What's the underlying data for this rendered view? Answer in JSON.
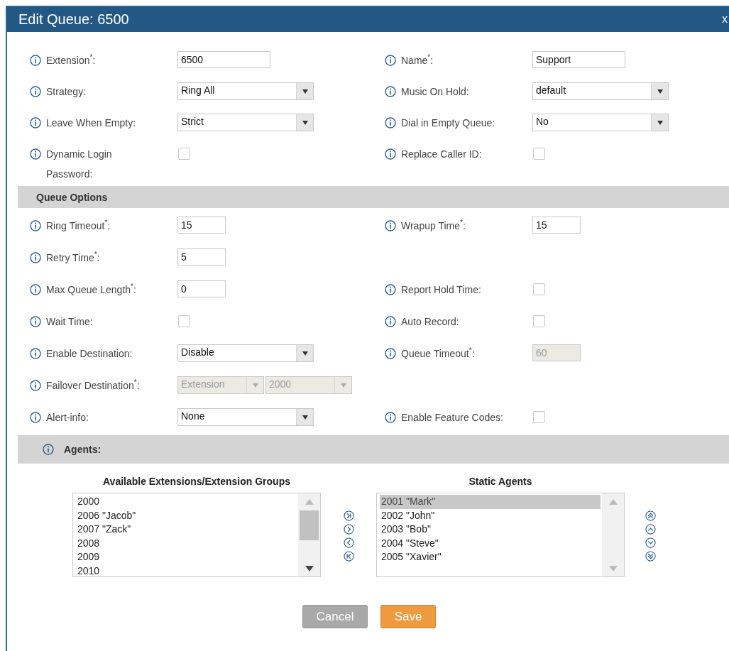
{
  "dialog": {
    "title": "Edit Queue: 6500",
    "close": "x"
  },
  "general_rows": [
    {
      "left": {
        "kind": "text",
        "label": "Extension$^{*}$:",
        "value": "6500",
        "disabled": false
      },
      "right": {
        "kind": "text",
        "label": "Name$^{*}$:",
        "value": "Support",
        "disabled": false
      }
    },
    {
      "left": {
        "kind": "select",
        "label": "Strategy:",
        "value": "Ring All",
        "disabled": false
      },
      "right": {
        "kind": "select",
        "label": "Music On Hold:",
        "value": "default",
        "disabled": false
      }
    },
    {
      "left": {
        "kind": "select",
        "label": "Leave When Empty:",
        "value": "Strict",
        "disabled": false
      },
      "right": {
        "kind": "select",
        "label": "Dial in Empty Queue:",
        "value": "No",
        "disabled": false
      }
    },
    {
      "left": {
        "kind": "checkbox",
        "label": "Dynamic Login Password:",
        "checked": false
      },
      "right": {
        "kind": "checkbox",
        "label": "Replace Caller ID:",
        "checked": false
      }
    }
  ],
  "queue_options": {
    "title": "Queue Options",
    "rows": [
      {
        "left": {
          "kind": "short_text",
          "label": "Ring Timeout$^{*}$:",
          "value": "15",
          "disabled": false
        },
        "right": {
          "kind": "short_text",
          "label": "Wrapup Time$^{*}$:",
          "value": "15",
          "disabled": false
        }
      },
      {
        "left": {
          "kind": "short_text",
          "label": "Retry Time$^{*}$:",
          "value": "5",
          "disabled": false
        }
      },
      {
        "left": {
          "kind": "short_text",
          "label": "Max Queue Length$^{*}$:",
          "value": "0",
          "disabled": false
        },
        "right": {
          "kind": "checkbox",
          "label": "Report Hold Time:",
          "checked": false
        }
      },
      {
        "left": {
          "kind": "checkbox",
          "label": "Wait Time:",
          "checked": false
        },
        "right": {
          "kind": "checkbox",
          "label": "Auto Record:",
          "checked": false
        }
      },
      {
        "left": {
          "kind": "select",
          "label": "Enable Destination:",
          "value": "Disable",
          "disabled": false
        },
        "right": {
          "kind": "short_text",
          "label": "Queue Timeout$^{*}$:",
          "value": "60",
          "disabled": true
        }
      },
      {
        "left": {
          "kind": "select_pair",
          "label": "Failover Destination$^{*}$:",
          "values": [
            "Extension",
            "2000"
          ],
          "disabled": true
        }
      },
      {
        "left": {
          "kind": "select",
          "label": "Alert-info:",
          "value": "None",
          "disabled": false
        },
        "right": {
          "kind": "checkbox",
          "label": "Enable Feature Codes:",
          "checked": false
        }
      }
    ]
  },
  "agents": {
    "title": "Agents:",
    "available": {
      "heading": "Available Extensions/Extension Groups",
      "items": [
        {
          "label": "2000",
          "selected": false
        },
        {
          "label": "2006 \"Jacob\"",
          "selected": false
        },
        {
          "label": "2007 \"Zack\"",
          "selected": false
        },
        {
          "label": "2008",
          "selected": false
        },
        {
          "label": "2009",
          "selected": false
        },
        {
          "label": "2010",
          "selected": false
        }
      ]
    },
    "static": {
      "heading": "Static Agents",
      "items": [
        {
          "label": "2001 \"Mark\"",
          "selected": true
        },
        {
          "label": "2002 \"John\"",
          "selected": false
        },
        {
          "label": "2003 \"Bob\"",
          "selected": false
        },
        {
          "label": "2004 \"Steve\"",
          "selected": false
        },
        {
          "label": "2005 \"Xavier\"",
          "selected": false
        }
      ]
    }
  },
  "buttons": [
    {
      "label": "Cancel",
      "kind": "cancel"
    },
    {
      "label": "Save",
      "kind": "save"
    }
  ]
}
